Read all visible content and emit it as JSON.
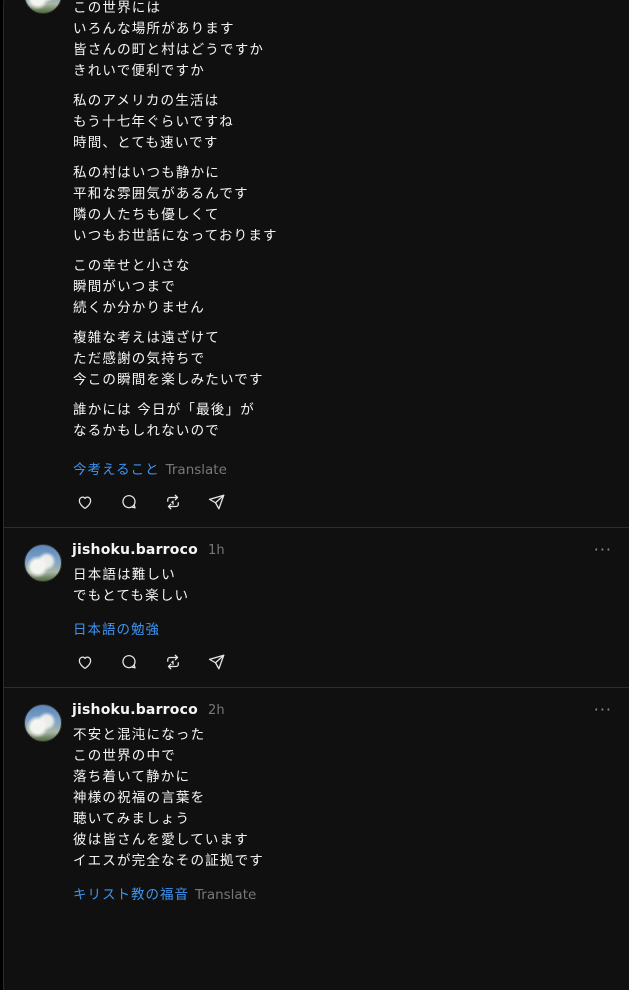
{
  "posts": [
    {
      "stanzas": [
        [
          "この世界には",
          "いろんな場所があります",
          "皆さんの町と村はどうですか",
          "きれいで便利ですか"
        ],
        [
          "私のアメリカの生活は",
          "もう十七年ぐらいですね",
          "時間、とても速いです"
        ],
        [
          "私の村はいつも静かに",
          "平和な雰囲気があるんです",
          "隣の人たちも優しくて",
          "いつもお世話になっております"
        ],
        [
          "この幸せと小さな",
          "瞬間がいつまで",
          "続くか分かりません"
        ],
        [
          "複雑な考えは遠ざけて",
          "ただ感謝の気持ちで",
          "今この瞬間を楽しみたいです"
        ],
        [
          "誰かには 今日が「最後」が",
          "なるかもしれないので"
        ]
      ],
      "tag": "今考えること",
      "translate": "Translate"
    },
    {
      "username": "jishoku.barroco",
      "time": "1h",
      "more": "···",
      "lines": [
        "日本語は難しい",
        "でもとても楽しい"
      ],
      "tag": "日本語の勉強"
    },
    {
      "username": "jishoku.barroco",
      "time": "2h",
      "more": "···",
      "lines": [
        "不安と混沌になった",
        "この世界の中で",
        "落ち着いて静かに",
        "神様の祝福の言葉を",
        "聴いてみましょう",
        "彼は皆さんを愛しています",
        "イエスが完全なその証拠です"
      ],
      "tag": "キリスト教の福音",
      "translate": "Translate"
    }
  ],
  "icons": [
    "heart-icon",
    "comment-icon",
    "repost-icon",
    "share-icon"
  ],
  "colors": {
    "background": "#101010",
    "text": "#f3f5f7",
    "muted": "#777777",
    "link": "#3d94f0"
  }
}
